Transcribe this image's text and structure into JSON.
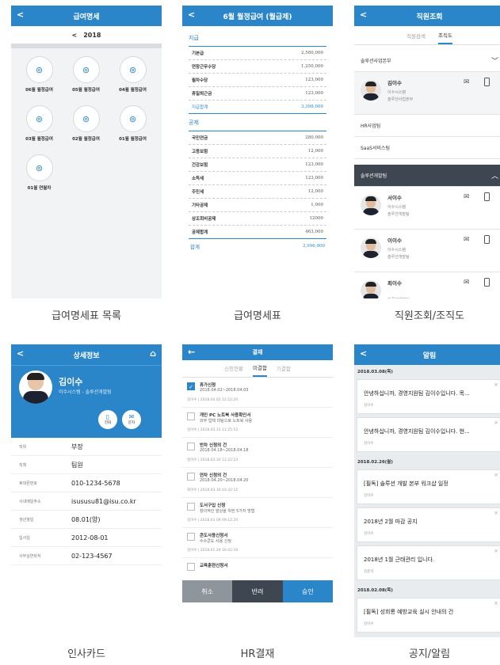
{
  "captions": [
    "급여명세표 목록",
    "급여명세표",
    "직원조회/조직도",
    "인사카드",
    "HR결재",
    "공지/알림"
  ],
  "s1": {
    "title": "급여명세",
    "year": "2018",
    "items": [
      "06월 월정급여",
      "05월 월정급여",
      "04월 월정급여",
      "03월 월정급여",
      "02월 월정급여",
      "01월 월정급여",
      "01월 연월차"
    ]
  },
  "s2": {
    "title": "6월 월정급여 (월급제)",
    "sec1": "지급",
    "pay": [
      [
        "기본급",
        "2,580,000"
      ],
      [
        "연장근무수당",
        "1,250,000"
      ],
      [
        "월차수당",
        "123,000"
      ],
      [
        "휴일퇴근금",
        "123,000"
      ]
    ],
    "pay_total": [
      "지급합계",
      "3,398,000"
    ],
    "sec2": "공제",
    "ded": [
      [
        "국민연금",
        "280,000"
      ],
      [
        "고용보험",
        "12,000"
      ],
      [
        "건강보험",
        "123,000"
      ],
      [
        "소득세",
        "123,000"
      ],
      [
        "주민세",
        "12,000"
      ],
      [
        "기타공제",
        "1,000"
      ],
      [
        "상조회비공제",
        "12000"
      ]
    ],
    "ded_total": [
      "공제합계",
      "463,000"
    ],
    "grand": [
      "합계",
      "2,996,000"
    ]
  },
  "s3": {
    "title": "직원조회",
    "tabs": [
      "직원검색",
      "조직도"
    ],
    "org1": "솔루션사업본부",
    "p1": {
      "name": "김이수",
      "dept": "이수시스템",
      "team": "솔루션사업본부"
    },
    "org2": "HR사업팀",
    "org3": "SaaS서비스팀",
    "org4": "솔루션개발팀",
    "people": [
      {
        "name": "서이수",
        "dept": "이수시스템",
        "team": "솔루션개발팀"
      },
      {
        "name": "이이수",
        "dept": "이수시스템",
        "team": "솔루션개발팀"
      },
      {
        "name": "최이수",
        "dept": "",
        "team": "솔루션개발팀"
      }
    ]
  },
  "s4": {
    "title": "상세정보",
    "name": "김이수",
    "sub": "이수시스템 - 솔루션개발팀",
    "btn1": "전화",
    "btn2": "문자",
    "rows": [
      [
        "직위",
        "부장"
      ],
      [
        "직책",
        "팀원"
      ],
      [
        "휴대폰번호",
        "010-1234-5678"
      ],
      [
        "사내메일주소",
        "isususu81@isu.co.kr"
      ],
      [
        "생년월일",
        "08.01(양)"
      ],
      [
        "입사일",
        "2012-08-01"
      ],
      [
        "사무실연락처",
        "02-123-4567"
      ]
    ]
  },
  "s5": {
    "title": "결재",
    "tabs": [
      "신청현황",
      "미결함",
      "기결함"
    ],
    "items": [
      {
        "t": "휴가신청",
        "d": "2018.04.02~2018.04.03",
        "m": "김이수 | 2018.04.02 12:52:20",
        "c": true
      },
      {
        "t": "개인 PC 노트북 사용확인서",
        "d": "외부 업체 미팅으로 노트북 사용",
        "m": "김이수 | 2018.03.31 11:25:53",
        "c": false
      },
      {
        "t": "반차 신청의 건",
        "d": "2018.04.18~2018.04.18",
        "m": "정이수 | 2018.03.30 12:22:23",
        "c": false
      },
      {
        "t": "연차 신청의 건",
        "d": "2018.04.20~2018.04.20",
        "m": "최이수 | 2018.03.30 03:32:15",
        "c": false
      },
      {
        "t": "도서구입 신청",
        "d": "창의적인 발상을 위한 5가지 방법",
        "m": "김이수 | 2018.03.09 09:12:20",
        "c": false
      },
      {
        "t": "콘도사용신청서",
        "d": "수수콘도 사용 신청",
        "m": "김이수 | 2018.01.29 16:42:19",
        "c": false
      },
      {
        "t": "교육훈련신청서",
        "d": "",
        "m": "",
        "c": false
      }
    ],
    "btns": [
      "취소",
      "반려",
      "승인"
    ]
  },
  "s6": {
    "title": "알림",
    "groups": [
      {
        "date": "2018.03.08(목)",
        "cards": [
          {
            "t": "안녕하십니까, 경영지원팀 김이수입니다. 목...",
            "a": "김이수"
          },
          {
            "t": "안녕하십니까, 경영지원팀 김이수입니다. 현...",
            "a": "김이수"
          }
        ]
      },
      {
        "date": "2018.02.26(월)",
        "cards": [
          {
            "t": "[필독] 솔루션 개발 본부 워크샵 일정",
            "a": "김이수"
          },
          {
            "t": "2018년 2월 마감 공지",
            "a": "김이수"
          },
          {
            "t": "2018년 1월 근태관리 입니다.",
            "a": "김준석"
          }
        ]
      },
      {
        "date": "2018.02.08(목)",
        "cards": [
          {
            "t": "[필독] 성희롱 예방교육 실시 안내의 건",
            "a": "김이수"
          }
        ]
      }
    ]
  }
}
